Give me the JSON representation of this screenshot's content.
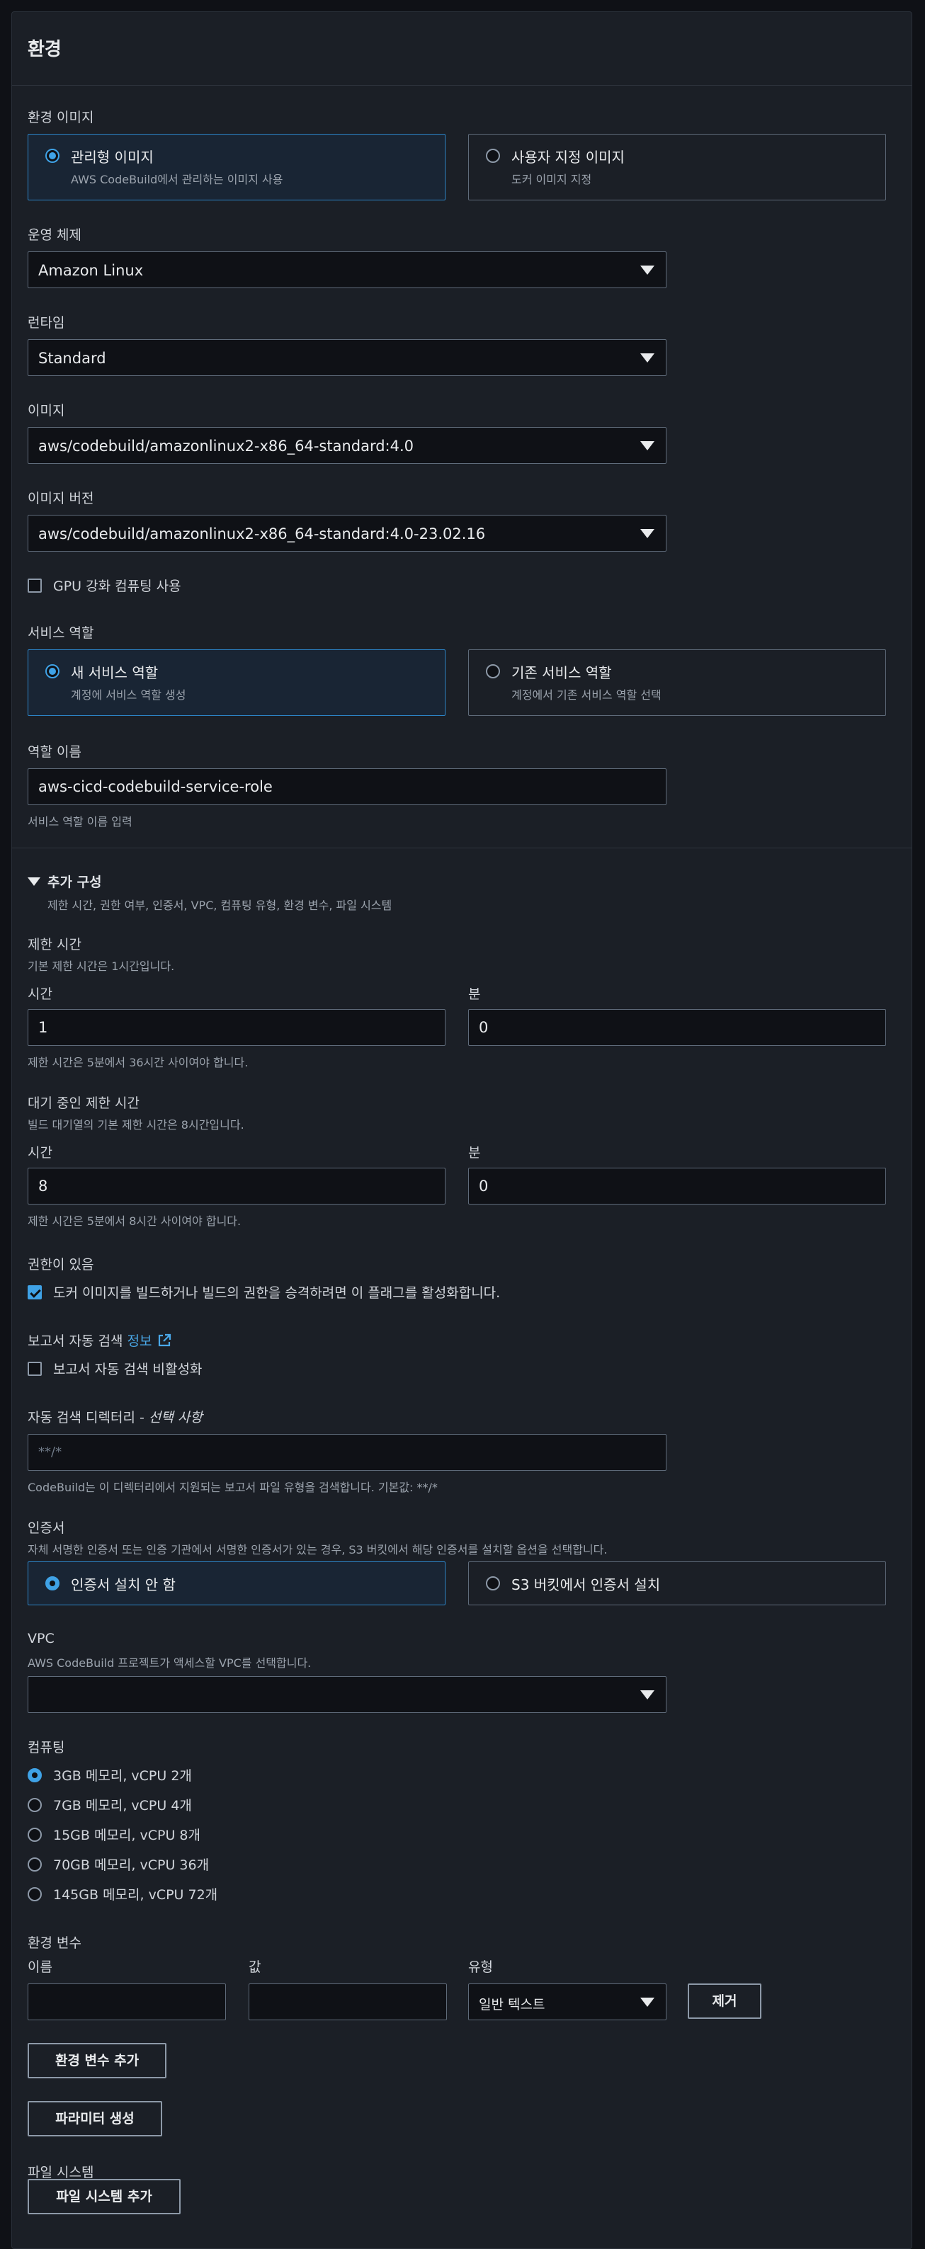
{
  "panel": {
    "title": "환경"
  },
  "env_image": {
    "label": "환경 이미지",
    "options": [
      {
        "title": "관리형 이미지",
        "desc": "AWS CodeBuild에서 관리하는 이미지 사용",
        "selected": true
      },
      {
        "title": "사용자 지정 이미지",
        "desc": "도커 이미지 지정",
        "selected": false
      }
    ]
  },
  "os": {
    "label": "운영 체제",
    "value": "Amazon Linux"
  },
  "runtime": {
    "label": "런타임",
    "value": "Standard"
  },
  "image": {
    "label": "이미지",
    "value": "aws/codebuild/amazonlinux2-x86_64-standard:4.0"
  },
  "image_version": {
    "label": "이미지 버전",
    "value": "aws/codebuild/amazonlinux2-x86_64-standard:4.0-23.02.16"
  },
  "gpu": {
    "label": "GPU 강화 컴퓨팅 사용",
    "checked": false
  },
  "service_role": {
    "label": "서비스 역할",
    "options": [
      {
        "title": "새 서비스 역할",
        "desc": "계정에 서비스 역할 생성",
        "selected": true
      },
      {
        "title": "기존 서비스 역할",
        "desc": "계정에서 기존 서비스 역할 선택",
        "selected": false
      }
    ]
  },
  "role_name": {
    "label": "역할 이름",
    "value": "aws-cicd-codebuild-service-role",
    "hint": "서비스 역할 이름 입력"
  },
  "additional": {
    "title": "추가 구성",
    "desc": "제한 시간, 권한 여부, 인증서, VPC, 컴퓨팅 유형, 환경 변수, 파일 시스템"
  },
  "timeout": {
    "label": "제한 시간",
    "desc": "기본 제한 시간은 1시간입니다.",
    "hours_label": "시간",
    "hours_value": "1",
    "minutes_label": "분",
    "minutes_value": "0",
    "hint": "제한 시간은 5분에서 36시간 사이여야 합니다."
  },
  "queued_timeout": {
    "label": "대기 중인 제한 시간",
    "desc": "빌드 대기열의 기본 제한 시간은 8시간입니다.",
    "hours_label": "시간",
    "hours_value": "8",
    "minutes_label": "분",
    "minutes_value": "0",
    "hint": "제한 시간은 5분에서 8시간 사이여야 합니다."
  },
  "privileged": {
    "label": "권한이 있음",
    "checkbox_label": "도커 이미지를 빌드하거나 빌드의 권한을 승격하려면 이 플래그를 활성화합니다.",
    "checked": true
  },
  "report_discovery": {
    "label": "보고서 자동 검색",
    "info": "정보",
    "checkbox_label": "보고서 자동 검색 비활성화",
    "checked": false
  },
  "discovery_dir": {
    "label": "자동 검색 디렉터리 - ",
    "label_optional": "선택 사항",
    "placeholder": "**/*",
    "hint": "CodeBuild는 이 디렉터리에서 지원되는 보고서 파일 유형을 검색합니다. 기본값: **/*"
  },
  "certificate": {
    "label": "인증서",
    "desc": "자체 서명한 인증서 또는 인증 기관에서 서명한 인증서가 있는 경우, S3 버킷에서 해당 인증서를 설치할 옵션을 선택합니다.",
    "options": [
      {
        "title": "인증서 설치 안 함",
        "selected": true
      },
      {
        "title": "S3 버킷에서 인증서 설치",
        "selected": false
      }
    ]
  },
  "vpc": {
    "label": "VPC",
    "desc": "AWS CodeBuild 프로젝트가 액세스할 VPC를 선택합니다.",
    "value": ""
  },
  "compute": {
    "label": "컴퓨팅",
    "options": [
      {
        "label": "3GB 메모리, vCPU 2개",
        "selected": true
      },
      {
        "label": "7GB 메모리, vCPU 4개",
        "selected": false
      },
      {
        "label": "15GB 메모리, vCPU 8개",
        "selected": false
      },
      {
        "label": "70GB 메모리, vCPU 36개",
        "selected": false
      },
      {
        "label": "145GB 메모리, vCPU 72개",
        "selected": false
      }
    ]
  },
  "env_vars": {
    "label": "환경 변수",
    "name_label": "이름",
    "value_label": "값",
    "type_label": "유형",
    "name_value": "",
    "value_value": "",
    "type_value": "일반 텍스트",
    "remove_button": "제거",
    "add_button": "환경 변수 추가",
    "param_button": "파라미터 생성"
  },
  "file_system": {
    "label": "파일 시스템",
    "add_button": "파일 시스템 추가"
  },
  "colors": {
    "accent": "#3fa2e6",
    "link": "#4aa8e8",
    "panel_bg": "#1b1f26",
    "page_bg": "#0f1116"
  }
}
